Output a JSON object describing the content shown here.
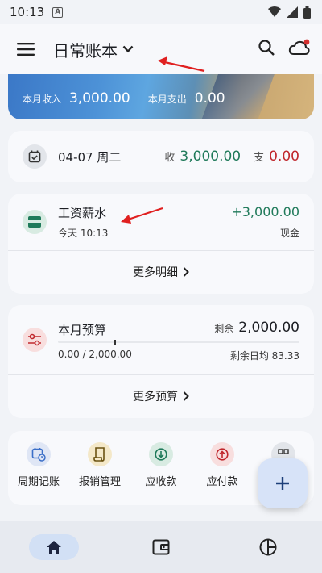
{
  "status_bar": {
    "time": "10:13",
    "notification_icon": "A"
  },
  "app_bar": {
    "title": "日常账本"
  },
  "banner": {
    "income_label": "本月收入",
    "income_value": "3,000.00",
    "expense_label": "本月支出",
    "expense_value": "0.00"
  },
  "day_summary": {
    "date": "04-07 周二",
    "income_label": "收",
    "income": "3,000.00",
    "expense_label": "支",
    "expense": "0.00"
  },
  "transaction": {
    "name": "工资薪水",
    "time": "今天 10:13",
    "amount": "+3,000.00",
    "account": "现金",
    "more_label": "更多明细"
  },
  "budget": {
    "name": "本月预算",
    "remain_label": "剩余",
    "remain_value": "2,000.00",
    "progress_text": "0.00 / 2,000.00",
    "daily_avg": "剩余日均 83.33",
    "more_label": "更多预算"
  },
  "quick_actions": [
    {
      "label": "周期记账",
      "icon": "calendar-clock-icon",
      "color": "#3b6fc8"
    },
    {
      "label": "报销管理",
      "icon": "receipt-icon",
      "color": "#8a6a1a"
    },
    {
      "label": "应收款",
      "icon": "arrow-down-circle-icon",
      "color": "#1f7a5a"
    },
    {
      "label": "应付款",
      "icon": "arrow-up-circle-icon",
      "color": "#c0282d"
    }
  ],
  "colors": {
    "income": "#207a5a",
    "expense": "#c0282d",
    "accent": "#3b78c7",
    "fab": "#d7e3f8"
  },
  "bottom_nav": [
    "home-icon",
    "wallet-icon",
    "pie-chart-icon"
  ]
}
